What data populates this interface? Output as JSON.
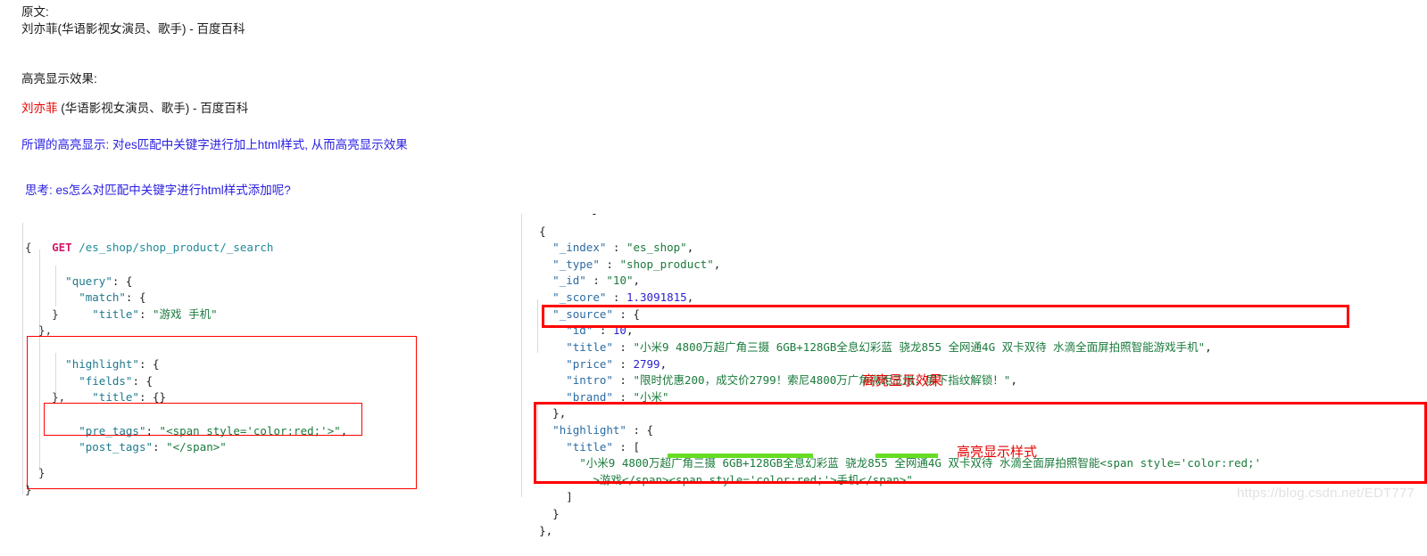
{
  "notes": {
    "original_label": "原文:",
    "original_text": "刘亦菲(华语影视女演员、歌手) - 百度百科",
    "highlight_label": "高亮显示效果:",
    "highlight_keyword": "刘亦菲",
    "highlight_rest": " (华语影视女演员、歌手) - 百度百科",
    "explain": "所谓的高亮显示: 对es匹配中关键字进行加上html样式, 从而高亮显示效果",
    "question": "思考: es怎么对匹配中关键字进行html样式添加呢?"
  },
  "request": {
    "method": "GET",
    "path": "/es_shop/shop_product/_search",
    "lines": [
      "{",
      "  \"query\": {",
      "    \"match\": {",
      "      \"title\": \"游戏 手机\"",
      "    }",
      "  },",
      "  \"highlight\": {",
      "    \"fields\": {",
      "      \"title\": {}",
      "    },",
      "    \"pre_tags\": \"<span style='color:red;'>\",",
      "    \"post_tags\": \"</span>\"",
      "",
      "  }",
      "}"
    ],
    "query_key": "\"query\"",
    "match_key": "\"match\"",
    "title_key": "\"title\"",
    "title_value": "\"游戏 手机\"",
    "highlight_key": "\"highlight\"",
    "fields_key": "\"fields\"",
    "fields_title_key": "\"title\"",
    "fields_title_value": "{}",
    "pre_tags_key": "\"pre_tags\"",
    "pre_tags_value": "\"<span style='color:red;'>\"",
    "post_tags_key": "\"post_tags\"",
    "post_tags_value": "\"</span>\""
  },
  "response": {
    "dash": "-",
    "open_brace": "{",
    "index_key": "\"_index\"",
    "index_value": "\"es_shop\"",
    "type_key": "\"_type\"",
    "type_value": "\"shop_product\"",
    "id_key": "\"_id\"",
    "id_value": "\"10\"",
    "score_key": "\"_score\"",
    "score_value": "1.3091815",
    "source_key": "\"_source\"",
    "src_id_key": "\"id\"",
    "src_id_value": "10",
    "src_title_key": "\"title\"",
    "src_title_value": "\"小米9 4800万超广角三摄 6GB+128GB全息幻彩蓝 骁龙855 全网通4G 双卡双待 水滴全面屏拍照智能游戏手机\"",
    "src_price_key": "\"price\"",
    "src_price_value": "2799",
    "src_intro_key": "\"intro\"",
    "src_intro_value": "\"限时优惠200，成交价2799！索尼4800万广角微距三摄，屏下指纹解锁！\"",
    "src_brand_key": "\"brand\"",
    "src_brand_value": "\"小米\"",
    "source_close": "},",
    "highlight_key": "\"highlight\"",
    "hl_title_key": "\"title\"",
    "hl_open_bracket": "[",
    "hl_line1": "\"小米9 4800万超广角三摄 6GB+128GB全息幻彩蓝 骁龙855 全网通4G 双卡双待 水滴全面屏拍照智能<span style='color:red;'",
    "hl_line2_a": ">游戏</span><span style='color:red;'>手机</span>\"",
    "hl_close_bracket": "]",
    "hl_close_brace": "}",
    "outer_close": "},"
  },
  "annotations": {
    "effect_label": "高亮显示效果",
    "style_label": "高亮显示样式"
  },
  "watermark": "https://blog.csdn.net/EDT777",
  "colors": {
    "red": "#ff0000",
    "green_mark": "#66dd22",
    "blue_note": "#2a1fe0",
    "string_green": "#1a7a3c",
    "key_teal": "#1f7a8c",
    "number_blue": "#2a1fd0",
    "verb_pink": "#d41a6e"
  }
}
